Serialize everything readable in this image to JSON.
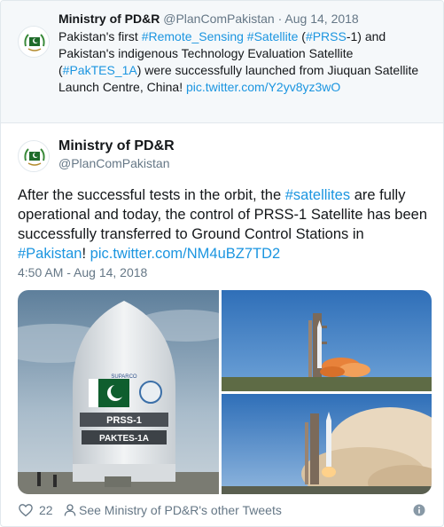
{
  "parent_tweet": {
    "author_name": "Ministry of PD&R",
    "handle": "@PlanComPakistan",
    "separator": "·",
    "date": "Aug 14, 2018",
    "text_parts": [
      {
        "t": "Pakistan's first ",
        "link": false
      },
      {
        "t": "#Remote_Sensing",
        "link": true
      },
      {
        "t": " ",
        "link": false
      },
      {
        "t": "#Satellite",
        "link": true
      },
      {
        "t": " (",
        "link": false
      },
      {
        "t": "#PRSS",
        "link": true
      },
      {
        "t": "-1) and Pakistan's indigenous Technology Evaluation Satellite (",
        "link": false
      },
      {
        "t": "#PakTES_1A",
        "link": true
      },
      {
        "t": ") were successfully launched from Jiuquan Satellite Launch Centre, China! ",
        "link": false
      },
      {
        "t": "pic.twitter.com/Y2yv8yz3wO",
        "link": true
      }
    ]
  },
  "tweet": {
    "author_name": "Ministry of PD&R",
    "handle": "@PlanComPakistan",
    "text_parts": [
      {
        "t": "After the successful tests in the orbit, the ",
        "link": false
      },
      {
        "t": "#satellites",
        "link": true
      },
      {
        "t": " are fully operational and today, the control of PRSS-1 Satellite has been successfully transferred to Ground Control Stations in ",
        "link": false
      },
      {
        "t": "#Pakistan",
        "link": true
      },
      {
        "t": "! ",
        "link": false
      },
      {
        "t": "pic.twitter.com/NM4uBZ7TD2",
        "link": true
      }
    ],
    "timestamp": "4:50 AM - Aug 14, 2018",
    "photo_fairing_labels": [
      "SUPARCO",
      "PRSS-1",
      "PAKTES-1A"
    ]
  },
  "footer": {
    "like_count": "22",
    "other_tweets_label": "See Ministry of PD&R's other Tweets"
  },
  "icons": {
    "like": "heart-icon",
    "profile": "person-icon",
    "info": "info-icon"
  },
  "colors": {
    "link": "#1b95e0",
    "secondary_text": "#657786",
    "quoted_bg": "#f5f8fa"
  }
}
